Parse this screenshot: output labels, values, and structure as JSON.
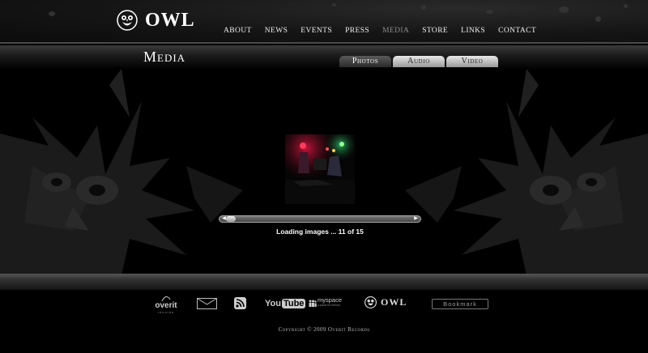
{
  "header": {
    "logo_text": "OWL",
    "nav": [
      {
        "label": "About",
        "active": false
      },
      {
        "label": "News",
        "active": false
      },
      {
        "label": "Events",
        "active": false
      },
      {
        "label": "Press",
        "active": false
      },
      {
        "label": "Media",
        "active": true
      },
      {
        "label": "Store",
        "active": false
      },
      {
        "label": "Links",
        "active": false
      },
      {
        "label": "Contact",
        "active": false
      }
    ]
  },
  "page": {
    "title": "Media",
    "tabs": [
      {
        "label": "Photos",
        "style": "dark"
      },
      {
        "label": "Audio",
        "style": "light"
      },
      {
        "label": "Video",
        "style": "light"
      }
    ]
  },
  "gallery": {
    "loading_text": "Loading images ... 11 of 15",
    "loaded": 11,
    "total": 15
  },
  "footer": {
    "overit_label": "overit",
    "overit_sub": "records",
    "youtube_you": "You",
    "youtube_tube": "Tube",
    "myspace_label": "myspace",
    "myspace_tagline": "a place for friends",
    "owl_label": "OWL",
    "bookmark_label": "Bookmark",
    "copyright": "Copyright © 2009 Overit Records"
  },
  "colors": {
    "background": "#000000",
    "nav_active": "#8d8d8d",
    "nav_text": "#eeeeee"
  }
}
